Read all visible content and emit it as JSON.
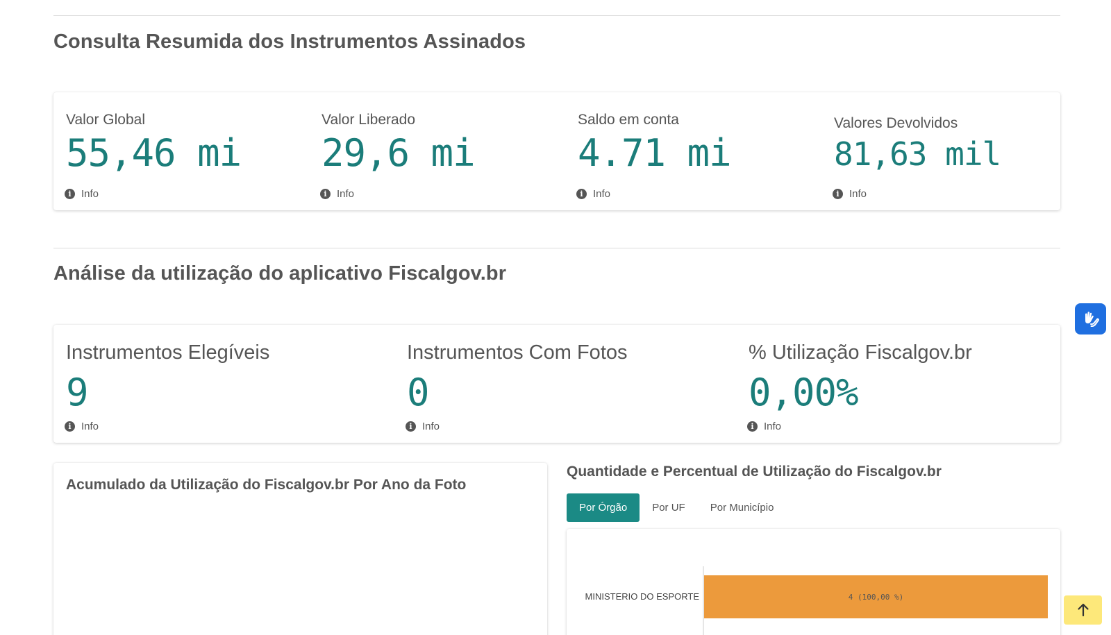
{
  "section1": {
    "title": "Consulta Resumida dos Instrumentos Assinados",
    "kpis": [
      {
        "label": "Valor Global",
        "value": "55,46 mi",
        "info": "Info"
      },
      {
        "label": "Valor Liberado",
        "value": "29,6 mi",
        "info": "Info"
      },
      {
        "label": "Saldo em conta",
        "value": "4.71 mi",
        "info": "Info"
      },
      {
        "label": "Valores Devolvidos",
        "value": "81,63 mil",
        "info": "Info"
      }
    ]
  },
  "section2": {
    "title": "Análise da utilização do aplicativo Fiscalgov.br",
    "kpis": [
      {
        "label": "Instrumentos Elegíveis",
        "value": "9",
        "info": "Info"
      },
      {
        "label": "Instrumentos Com Fotos",
        "value": "0",
        "info": "Info"
      },
      {
        "label": "% Utilização Fiscalgov.br",
        "value": "0,00%",
        "info": "Info"
      }
    ]
  },
  "left_panel": {
    "title": "Acumulado da Utilização do Fiscalgov.br Por Ano da Foto"
  },
  "right_panel": {
    "title": "Quantidade e Percentual de Utilização do Fiscalgov.br",
    "tabs": [
      {
        "label": "Por Órgão",
        "active": true
      },
      {
        "label": "Por UF",
        "active": false
      },
      {
        "label": "Por Município",
        "active": false
      }
    ]
  },
  "chart_data": {
    "type": "bar",
    "orientation": "horizontal",
    "categories": [
      "MINISTERIO DO ESPORTE"
    ],
    "values": [
      4
    ],
    "data_labels": [
      "4 (100,00 %)"
    ],
    "color": "#ec9a3c"
  },
  "colors": {
    "accent": "#1b7d7a",
    "tab_active": "#1b8a85",
    "bar": "#ec9a3c",
    "vlibras": "#1f6fe0",
    "scroll_top": "#fde87a"
  },
  "icons": {
    "info": "info-icon",
    "vlibras": "sign-language-hands-icon",
    "scroll_top": "arrow-up-icon"
  }
}
